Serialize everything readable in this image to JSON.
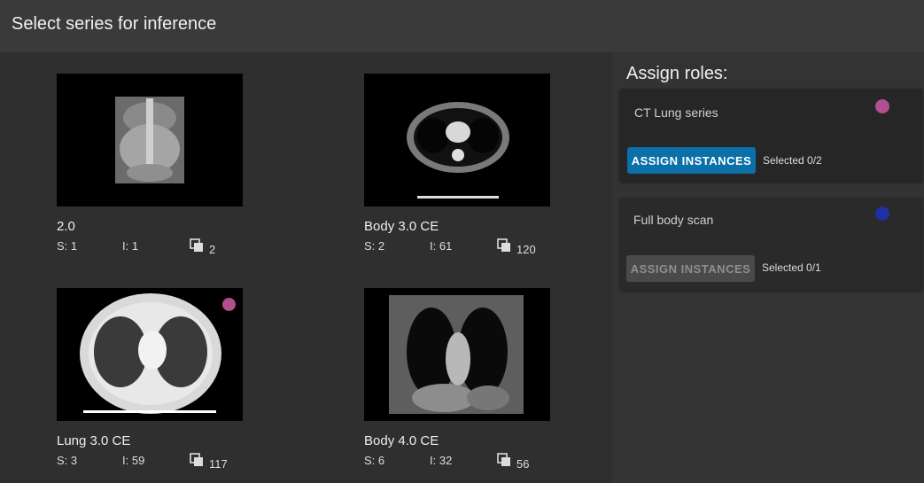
{
  "header": {
    "title": "Select series for inference"
  },
  "series": [
    {
      "name": "2.0",
      "s_label": "S: 1",
      "i_label": "I: 1",
      "count": "2",
      "has_dot": false
    },
    {
      "name": "Body 3.0 CE",
      "s_label": "S: 2",
      "i_label": "I: 61",
      "count": "120",
      "has_dot": false
    },
    {
      "name": "Lung 3.0 CE",
      "s_label": "S: 3",
      "i_label": "I: 59",
      "count": "117",
      "has_dot": true
    },
    {
      "name": "Body 4.0 CE",
      "s_label": "S: 6",
      "i_label": "I: 32",
      "count": "56",
      "has_dot": false
    }
  ],
  "roles": {
    "title": "Assign roles:",
    "items": [
      {
        "name": "CT Lung series",
        "button": "ASSIGN INSTANCES",
        "selected": "Selected 0/2",
        "color": "#b0508f"
      },
      {
        "name": "Full body scan",
        "button": "ASSIGN INSTANCES",
        "selected": "Selected 0/1",
        "color": "#2030a0"
      }
    ]
  },
  "colors": {
    "series_dot": "#b0508f",
    "accent_button": "#0b6fa8"
  }
}
